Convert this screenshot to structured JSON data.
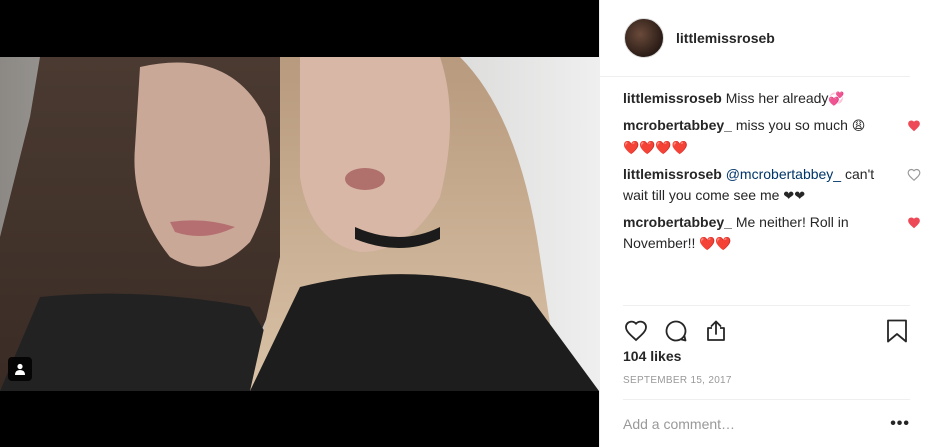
{
  "post": {
    "username": "littlemissroseb",
    "avatar_icon": "avatar-photo"
  },
  "comments": [
    {
      "user": "littlemissroseb",
      "text": "Miss her already",
      "emoji": "💞",
      "liked": null
    },
    {
      "user": "mcrobertabbey_",
      "text": "miss you so much",
      "emoji": "😩",
      "emoji2": "❤️❤️❤️❤️",
      "liked": true
    },
    {
      "user": "littlemissroseb",
      "mention": "@mcrobertabbey_",
      "text": "can't wait till you come see me",
      "emoji": "❤❤",
      "liked": false
    },
    {
      "user": "mcrobertabbey_",
      "text": "Me neither! Roll in November!!",
      "emoji": "❤️❤️",
      "liked": true
    }
  ],
  "actions": {
    "like_icon": "heart-outline-icon",
    "comment_icon": "comment-icon",
    "share_icon": "share-icon",
    "save_icon": "bookmark-icon"
  },
  "likes": "104 likes",
  "date": "SEPTEMBER 15, 2017",
  "add_comment": {
    "placeholder": "Add a comment…"
  },
  "more_label": "•••",
  "colors": {
    "like_red": "#ed4956",
    "border": "#efefef",
    "muted": "#999999"
  }
}
